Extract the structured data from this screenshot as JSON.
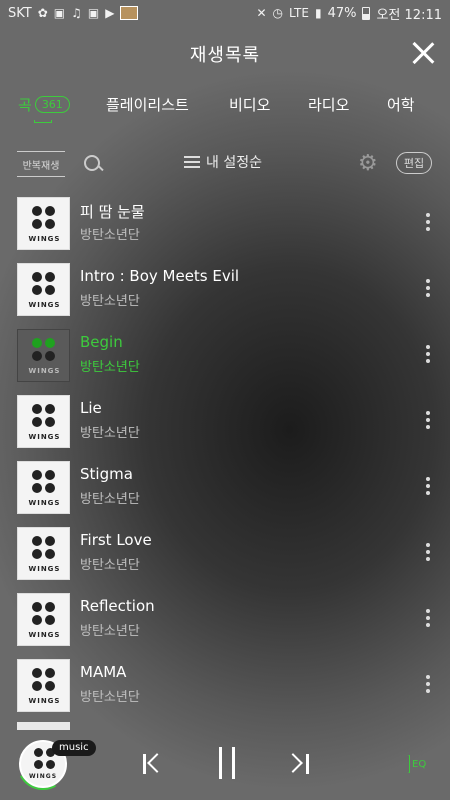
{
  "status_bar": {
    "carrier": "SKT",
    "network": "LTE",
    "battery": "47%",
    "time": "오전 12:11"
  },
  "header": {
    "title": "재생목록"
  },
  "tabs": [
    {
      "label": "곡",
      "count": "361",
      "active": true
    },
    {
      "label": "플레이리스트"
    },
    {
      "label": "비디오"
    },
    {
      "label": "라디오"
    },
    {
      "label": "어학"
    }
  ],
  "toolbar": {
    "repeat_label": "반복재생",
    "sort_label": "내 설정순",
    "edit_label": "편집"
  },
  "songs": [
    {
      "title": "피 땀 눈물",
      "artist": "방탄소년단",
      "album_label": "WINGS"
    },
    {
      "title": "Intro : Boy Meets Evil",
      "artist": "방탄소년단",
      "album_label": "WINGS"
    },
    {
      "title": "Begin",
      "artist": "방탄소년단",
      "album_label": "WINGS",
      "playing": true
    },
    {
      "title": "Lie",
      "artist": "방탄소년단",
      "album_label": "WINGS"
    },
    {
      "title": "Stigma",
      "artist": "방탄소년단",
      "album_label": "WINGS"
    },
    {
      "title": "First Love",
      "artist": "방탄소년단",
      "album_label": "WINGS"
    },
    {
      "title": "Reflection",
      "artist": "방탄소년단",
      "album_label": "WINGS"
    },
    {
      "title": "MAMA",
      "artist": "방탄소년단",
      "album_label": "WINGS"
    }
  ],
  "player": {
    "badge": "music",
    "album_label": "WINGS",
    "eq_label": "EQ"
  },
  "colors": {
    "accent": "#3dcb3d"
  }
}
